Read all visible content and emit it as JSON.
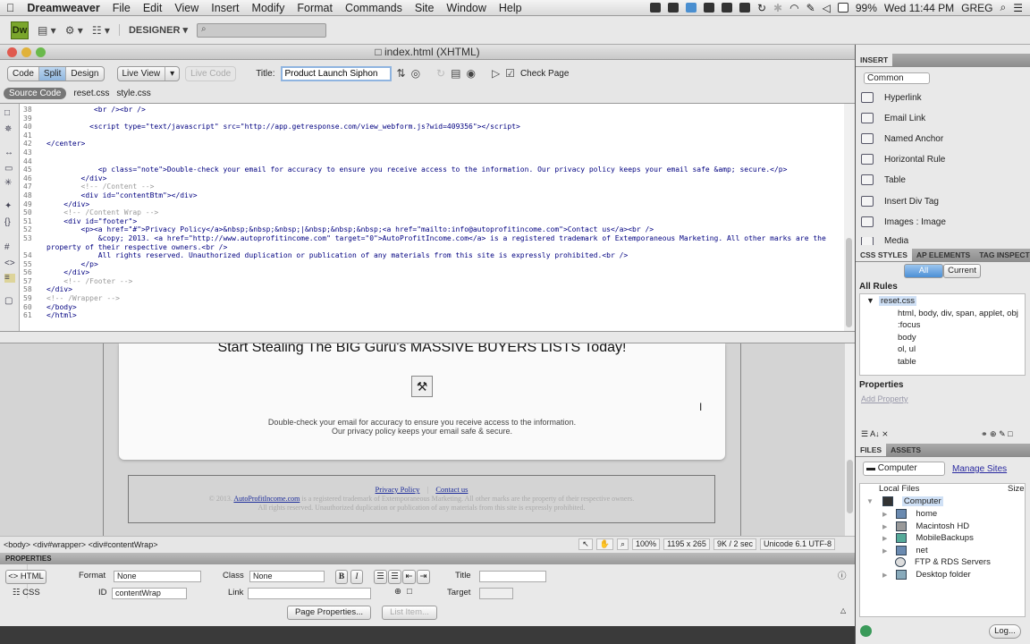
{
  "menubar": {
    "app": "Dreamweaver",
    "items": [
      "File",
      "Edit",
      "View",
      "Insert",
      "Modify",
      "Format",
      "Commands",
      "Site",
      "Window",
      "Help"
    ],
    "battery": "99%",
    "clock": "Wed 11:44 PM",
    "user": "GREG"
  },
  "apptoolbar": {
    "logo": "Dw",
    "workspace": "DESIGNER ▾"
  },
  "document": {
    "window_title": "index.html (XHTML)",
    "views": [
      "Code",
      "Split",
      "Design"
    ],
    "active_view": "Split",
    "live_view": "Live View",
    "live_code": "Live Code",
    "title_label": "Title:",
    "title_value": "Product Launch Siphon",
    "check_page": "Check Page",
    "related_files": [
      "Source Code",
      "reset.css",
      "style.css"
    ]
  },
  "code_lines": [
    {
      "n": "38",
      "t": "           <br /><br />",
      "k": "tag"
    },
    {
      "n": "39",
      "t": "",
      "k": "tag"
    },
    {
      "n": "40",
      "t": "          <script type=\"text/javascript\" src=\"http://app.getresponse.com/view_webform.js?wid=409356\"></script>",
      "k": "tag"
    },
    {
      "n": "41",
      "t": "",
      "k": "tag"
    },
    {
      "n": "42",
      "t": "</center>",
      "k": "tag"
    },
    {
      "n": "43",
      "t": "",
      "k": "tag"
    },
    {
      "n": "44",
      "t": "",
      "k": "tag"
    },
    {
      "n": "45",
      "t": "            <p class=\"note\">Double-check your email for accuracy to ensure you receive access to the information. Our privacy policy keeps your email safe &amp; secure.</p>",
      "k": "tag"
    },
    {
      "n": "46",
      "t": "        </div>",
      "k": "tag"
    },
    {
      "n": "47",
      "t": "        <!-- /Content -->",
      "k": "cm"
    },
    {
      "n": "48",
      "t": "        <div id=\"contentBtm\"></div>",
      "k": "tag"
    },
    {
      "n": "49",
      "t": "    </div>",
      "k": "tag"
    },
    {
      "n": "50",
      "t": "    <!-- /Content Wrap -->",
      "k": "cm"
    },
    {
      "n": "51",
      "t": "    <div id=\"footer\">",
      "k": "tag"
    },
    {
      "n": "52",
      "t": "        <p><a href=\"#\">Privacy Policy</a>&nbsp;&nbsp;&nbsp;|&nbsp;&nbsp;&nbsp;<a href=\"mailto:info@autoprofitincome.com\">Contact us</a><br />",
      "k": "tag"
    },
    {
      "n": "53",
      "t": "            &copy; 2013. <a href=\"http://www.autoprofitincome.com\" target=\"0\">AutoProfitIncome.com</a> is a registered trademark of Extemporaneous Marketing. All other marks are the property of their respective owners.<br />",
      "k": "tag"
    },
    {
      "n": "54",
      "t": "            All rights reserved. Unauthorized duplication or publication of any materials from this site is expressly prohibited.<br />",
      "k": "tag"
    },
    {
      "n": "55",
      "t": "        </p>",
      "k": "tag"
    },
    {
      "n": "56",
      "t": "    </div>",
      "k": "tag"
    },
    {
      "n": "57",
      "t": "    <!-- /Footer -->",
      "k": "cm"
    },
    {
      "n": "58",
      "t": "</div>",
      "k": "tag"
    },
    {
      "n": "59",
      "t": "<!-- /Wrapper -->",
      "k": "cm"
    },
    {
      "n": "60",
      "t": "</body>",
      "k": "tag"
    },
    {
      "n": "61",
      "t": "</html>",
      "k": "tag"
    }
  ],
  "design": {
    "headline": "Start Stealing The BIG Guru's MASSIVE BUYERS LISTS Today!",
    "note_line1": "Double-check your email for accuracy to ensure you receive access to the information.",
    "note_line2": "Our privacy policy keeps your email safe & secure.",
    "privacy_link": "Privacy Policy",
    "separator": "|",
    "contact_link": "Contact us",
    "copyright_prefix": "© 2013.",
    "site_link": "AutoProfitIncome.com",
    "copyright_rest": "is a registered trademark of Extemporaneous Marketing. All other marks are the property of their respective owners.",
    "rights": "All rights reserved. Unauthorized duplication or publication of any materials from this site is expressly prohibited."
  },
  "statusbar": {
    "tag_selector": "<body> <div#wrapper> <div#contentWrap>",
    "zoom": "100%",
    "size": "1195 x 265",
    "download": "9K / 2 sec",
    "encoding": "Unicode 6.1 UTF-8"
  },
  "properties": {
    "header": "PROPERTIES",
    "html_tab": "<> HTML",
    "css_tab": "CSS",
    "format_label": "Format",
    "format_value": "None",
    "class_label": "Class",
    "class_value": "None",
    "id_label": "ID",
    "id_value": "contentWrap",
    "link_label": "Link",
    "link_value": "",
    "title_label": "Title",
    "title_value": "",
    "target_label": "Target",
    "target_value": "",
    "bold": "B",
    "italic": "I",
    "page_properties": "Page Properties...",
    "list_item": "List Item..."
  },
  "insert_panel": {
    "tab": "INSERT",
    "category": "Common",
    "items": [
      "Hyperlink",
      "Email Link",
      "Named Anchor",
      "Horizontal Rule",
      "Table",
      "Insert Div Tag",
      "Images : Image",
      "Media"
    ]
  },
  "css_panel": {
    "tabs": [
      "CSS STYLES",
      "AP ELEMENTS",
      "TAG INSPECTOR"
    ],
    "modes": [
      "All",
      "Current"
    ],
    "all_rules": "All Rules",
    "stylesheet": "reset.css",
    "rules": [
      "html, body, div, span, applet, object",
      "focus",
      "body",
      "ol, ul",
      "table"
    ],
    "properties_label": "Properties",
    "add_property": "Add Property"
  },
  "files_panel": {
    "tabs": [
      "FILES",
      "ASSETS"
    ],
    "location": "Computer",
    "manage_sites": "Manage Sites",
    "col_local": "Local Files",
    "col_size": "Size",
    "root": "Computer",
    "items": [
      "home",
      "Macintosh HD",
      "MobileBackups",
      "net",
      "FTP & RDS Servers",
      "Desktop folder"
    ],
    "log_button": "Log..."
  }
}
